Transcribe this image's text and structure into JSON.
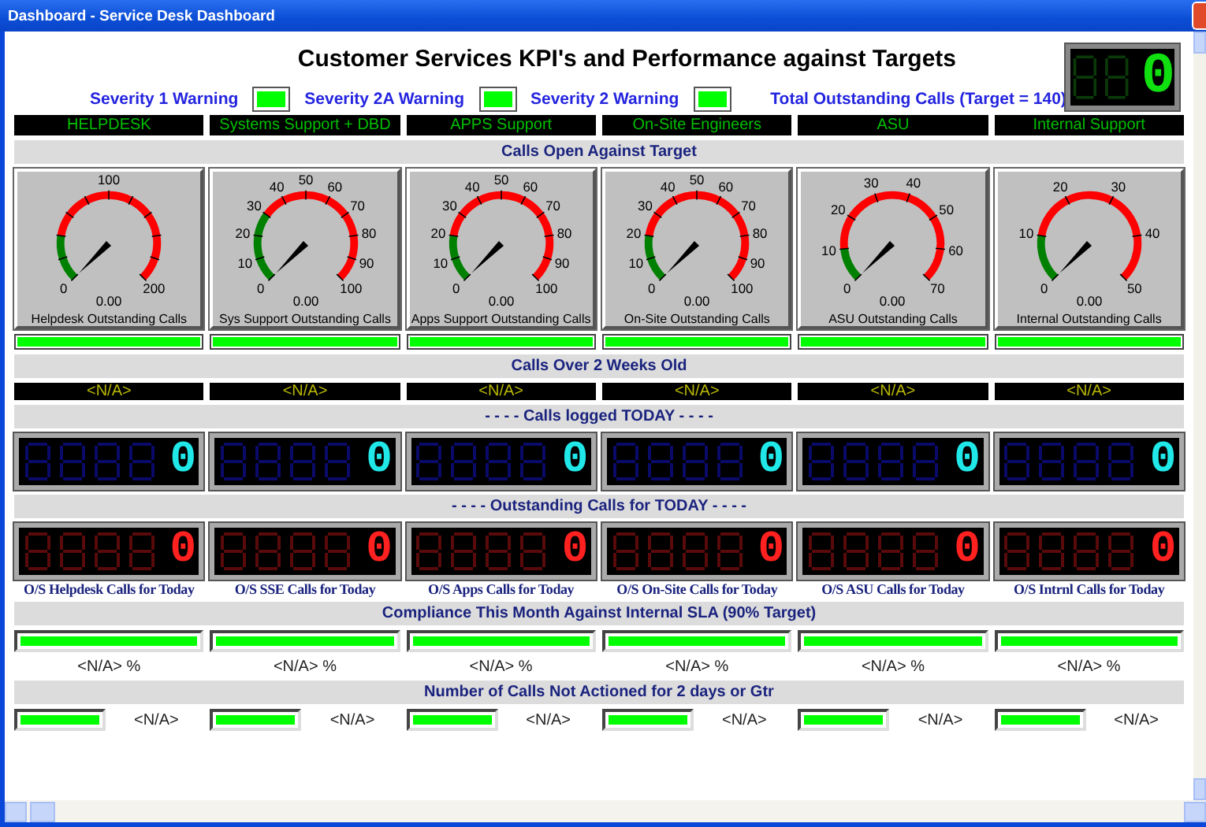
{
  "window": {
    "title": "Dashboard - Service Desk Dashboard"
  },
  "title": "Customer Services KPI's and Performance against Targets",
  "warnings": [
    {
      "label": "Severity 1 Warning",
      "on": true
    },
    {
      "label": "Severity 2A Warning",
      "on": true
    },
    {
      "label": "Severity 2 Warning",
      "on": true
    }
  ],
  "total": {
    "label": "Total Outstanding Calls (Target = 140)",
    "display": "0"
  },
  "teams": [
    "HELPDESK",
    "Systems Support + DBD",
    "APPS Support",
    "On-Site Engineers",
    "ASU",
    "Internal Support"
  ],
  "calls_open": {
    "heading": "Calls Open Against Target",
    "gauges": [
      {
        "scale": [
          "0",
          "100",
          "200"
        ],
        "reading": "0.00",
        "caption": "Helpdesk Outstanding Calls"
      },
      {
        "scale": [
          "0",
          "10",
          "20",
          "30",
          "40",
          "50",
          "60",
          "70",
          "80",
          "90",
          "100"
        ],
        "reading": "0.00",
        "caption": "Sys Support Outstanding Calls"
      },
      {
        "scale": [
          "0",
          "10",
          "20",
          "30",
          "40",
          "50",
          "60",
          "70",
          "80",
          "90",
          "100"
        ],
        "reading": "0.00",
        "caption": "Apps Support Outstanding Calls"
      },
      {
        "scale": [
          "0",
          "10",
          "20",
          "30",
          "40",
          "50",
          "60",
          "70",
          "80",
          "90",
          "100"
        ],
        "reading": "0.00",
        "caption": "On-Site Outstanding Calls"
      },
      {
        "scale": [
          "0",
          "10",
          "20",
          "30",
          "40",
          "50",
          "60",
          "70"
        ],
        "reading": "0.00",
        "caption": "ASU Outstanding Calls"
      },
      {
        "scale": [
          "0",
          "10",
          "20",
          "30",
          "40",
          "50"
        ],
        "reading": "0.00",
        "caption": "Internal  Outstanding Calls"
      }
    ],
    "bars": [
      {
        "level": 1
      },
      {
        "level": 1
      },
      {
        "level": 1
      },
      {
        "level": 1
      },
      {
        "level": 1
      },
      {
        "level": 1
      }
    ]
  },
  "over_2_weeks": {
    "heading": "Calls Over 2 Weeks Old",
    "values": [
      "<N/A>",
      "<N/A>",
      "<N/A>",
      "<N/A>",
      "<N/A>",
      "<N/A>"
    ]
  },
  "logged_today": {
    "heading": "- - - - Calls logged TODAY - - - -",
    "counters": [
      "0",
      "0",
      "0",
      "0",
      "0",
      "0"
    ]
  },
  "outstanding_today": {
    "heading": "- - - - Outstanding Calls for TODAY - - - -",
    "counters": [
      {
        "value": "0",
        "caption": "O/S Helpdesk Calls for Today"
      },
      {
        "value": "0",
        "caption": "O/S SSE Calls for Today"
      },
      {
        "value": "0",
        "caption": "O/S Apps Calls for Today"
      },
      {
        "value": "0",
        "caption": "O/S On-Site Calls for Today"
      },
      {
        "value": "0",
        "caption": "O/S ASU Calls for Today"
      },
      {
        "value": "0",
        "caption": "O/S Intrnl Calls for Today"
      }
    ]
  },
  "compliance": {
    "heading": "Compliance This Month Against Internal SLA (90% Target)",
    "items": [
      {
        "level": 1,
        "text": "<N/A> %"
      },
      {
        "level": 1,
        "text": "<N/A> %"
      },
      {
        "level": 1,
        "text": "<N/A> %"
      },
      {
        "level": 1,
        "text": "<N/A> %"
      },
      {
        "level": 1,
        "text": "<N/A> %"
      },
      {
        "level": 1,
        "text": "<N/A> %"
      }
    ]
  },
  "not_actioned": {
    "heading": "Number of Calls Not Actioned for 2 days or Gtr",
    "items": [
      {
        "level": 1,
        "text": "<N/A>"
      },
      {
        "level": 1,
        "text": "<N/A>"
      },
      {
        "level": 1,
        "text": "<N/A>"
      },
      {
        "level": 1,
        "text": "<N/A>"
      },
      {
        "level": 1,
        "text": "<N/A>"
      },
      {
        "level": 1,
        "text": "<N/A>"
      }
    ]
  }
}
